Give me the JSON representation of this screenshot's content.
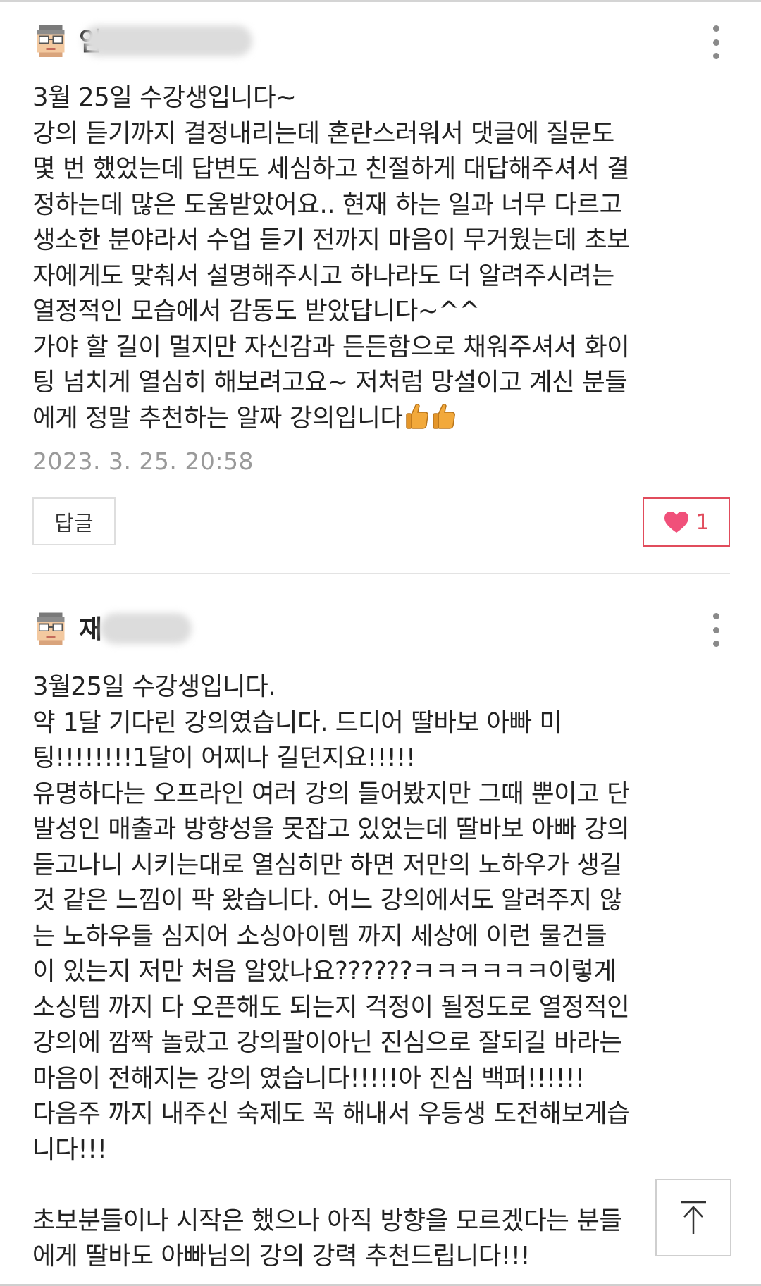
{
  "comments": [
    {
      "author_visible": "임",
      "author_avatar_icon": "pixel-glasses-avatar-icon",
      "more_icon": "more-vertical-icon",
      "lines": [
        "3월 25일 수강생입니다~",
        "강의 듣기까지 결정내리는데 혼란스러워서 댓글에 질문도",
        "몇 번 했었는데 답변도 세심하고 친절하게 대답해주셔서 결",
        "정하는데 많은 도움받았어요.. 현재 하는 일과 너무 다르고",
        "생소한 분야라서 수업 듣기 전까지 마음이 무거웠는데 초보",
        "자에게도 맞춰서 설명해주시고 하나라도 더 알려주시려는",
        "열정적인 모습에서 감동도 받았답니다~^^",
        "가야 할 길이 멀지만 자신감과 든든함으로 채워주셔서 화이",
        "팅 넘치게 열심히 해보려고요~ 저처럼 망설이고 계신 분들",
        "에게 정말 추천하는 알짜 강의입니다"
      ],
      "trailing_emoji": "thumbs-up-icon",
      "timestamp": "2023. 3. 25. 20:58",
      "reply_label": "답글",
      "like_icon": "heart-icon",
      "like_count": "1",
      "like_color": "#e14c5c"
    },
    {
      "author_visible": "재",
      "author_avatar_icon": "pixel-glasses-avatar-icon",
      "more_icon": "more-vertical-icon",
      "lines": [
        "3월25일 수강생입니다.",
        "약 1달 기다린 강의였습니다. 드디어 딸바보 아빠 미",
        "팅!!!!!!!!1달이 어찌나 길던지요!!!!!",
        "유명하다는 오프라인 여러 강의 들어봤지만 그때 뿐이고 단",
        "발성인 매출과 방향성을 못잡고 있었는데 딸바보 아빠 강의",
        "듣고나니  시키는대로 열심히만 하면 저만의 노하우가 생길",
        "것 같은 느낌이 팍 왔습니다. 어느 강의에서도 알려주지 않",
        "는  노하우들 심지어 소싱아이템 까지 세상에 이런 물건들",
        "이 있는지 저만 처음 알았나요??????ㅋㅋㅋㅋㅋㅋ이렇게",
        "소싱템 까지 다 오픈해도 되는지 걱정이 될정도로 열정적인",
        "강의에 깜짝 놀랐고 강의팔이아닌 진심으로 잘되길 바라는",
        "마음이 전해지는 강의 였습니다!!!!!아 진심 백퍼!!!!!!",
        "다음주 까지 내주신 숙제도 꼭 해내서 우등생 도전해보게습",
        "니다!!!",
        "",
        "초보분들이나 시작은 했으나 아직 방향을 모르겠다는 분들",
        "에게 딸바도 아빠님의 강의 강력 추천드립니다!!!"
      ]
    }
  ],
  "scroll_top_icon": "arrow-up-to-top-icon",
  "colors": {
    "accent_like": "#e14c5c",
    "timestamp": "#9a9a9a",
    "text": "#222222"
  }
}
